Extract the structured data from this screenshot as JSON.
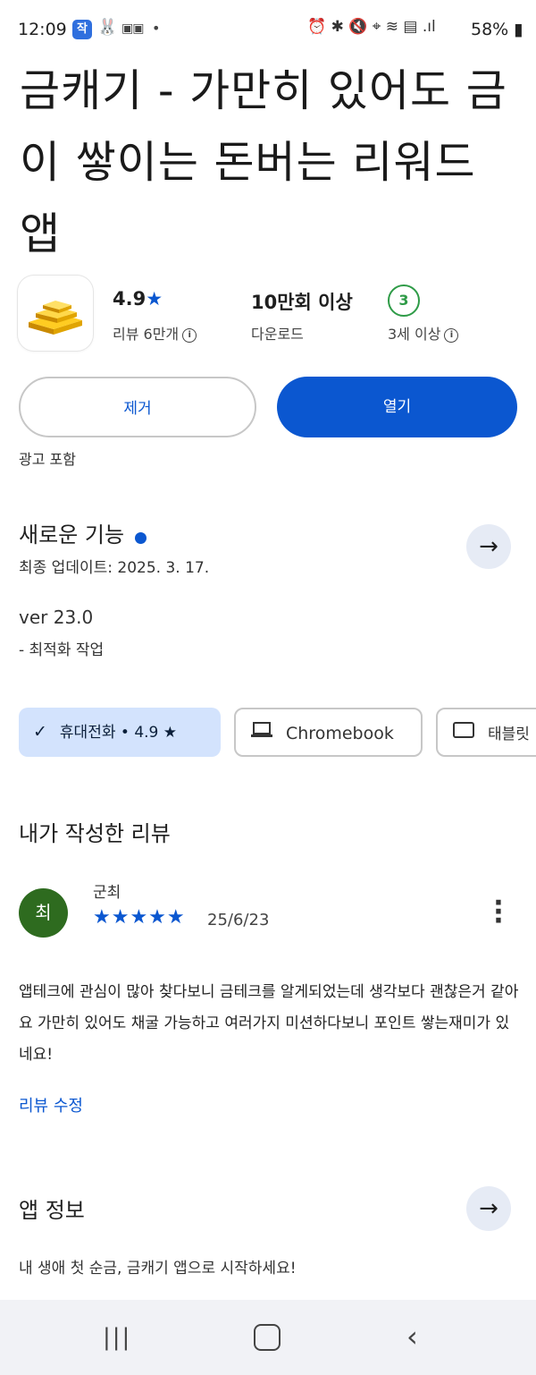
{
  "status_bar": {
    "time": "12:09",
    "app_badge": "작",
    "battery": "58%"
  },
  "app": {
    "title": "금캐기 - 가만히 있어도 금이 쌓이는 돈버는 리워드 앱",
    "rating": "4.9",
    "reviews": "리뷰 6만개",
    "downloads": "10만회 이상",
    "downloads_label": "다운로드",
    "age_rating": "3",
    "age_label": "3세 이상"
  },
  "actions": {
    "remove_label": "제거",
    "open_label": "열기",
    "ads_note": "광고 포함"
  },
  "whats_new": {
    "title": "새로운 기능",
    "updated": "최종 업데이트: 2025. 3. 17.",
    "version": "ver 23.0",
    "notes": "- 최적화 작업"
  },
  "devices": {
    "phone": "휴대전화 • 4.9 ★",
    "chromebook": "Chromebook",
    "tablet": "태블릿"
  },
  "my_review": {
    "section_title": "내가 작성한 리뷰",
    "avatar_letter": "최",
    "author": "군최",
    "stars": "★★★★★",
    "date": "25/6/23",
    "body": "앱테크에 관심이 많아 찾다보니 금테크를 알게되었는데 생각보다 괜찮은거 같아요 가만히 있어도 채굴 가능하고 여러가지 미션하다보니 포인트 쌓는재미가 있네요!",
    "edit_label": "리뷰 수정"
  },
  "app_info": {
    "title": "앱 정보",
    "description": "내 생애 첫 순금, 금캐기 앱으로 시작하세요!"
  },
  "colors": {
    "accent": "#0b57d0",
    "chip_selected": "#d3e3fd",
    "avatar": "#2e6b1f",
    "age_badge": "#2e9b47"
  },
  "icons": [
    "gold-bars-icon",
    "star-icon",
    "info-icon",
    "arrow-right-icon",
    "check-icon",
    "laptop-icon",
    "tablet-icon",
    "more-vert-icon",
    "recent-apps-icon",
    "home-icon",
    "back-icon"
  ]
}
